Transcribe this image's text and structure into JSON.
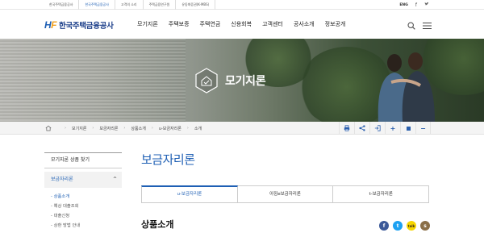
{
  "topbar": {
    "tabs": [
      {
        "label": "한국주택금융공사",
        "active": false
      },
      {
        "label": "한국주택금융공사",
        "active": true
      },
      {
        "label": "고객의 소리",
        "active": false
      },
      {
        "label": "주택금융연구원",
        "active": false
      },
      {
        "label": "유동화증권(K-MBS)",
        "active": false
      }
    ],
    "lang": "ENG",
    "facebook": "f",
    "twitter": "t"
  },
  "header": {
    "logo_mark": "HF",
    "logo_text": "한국주택금융공사",
    "nav": [
      "모기지론",
      "주택보증",
      "주택연금",
      "신용회복",
      "고객센터",
      "공사소개",
      "정보공개"
    ]
  },
  "hero": {
    "title": "모기지론"
  },
  "breadcrumb": [
    "모기지론",
    "보금자리론",
    "상품소개",
    "u-보금자리론",
    "소개"
  ],
  "tools": [
    "print",
    "share",
    "home",
    "plus",
    "stop",
    "minus"
  ],
  "lnb": {
    "title": "모기지론 상품 찾기",
    "section": "보금자리론",
    "section_caret": "^",
    "items": [
      {
        "label": "- 상품소개",
        "active": true
      },
      {
        "label": "- 예상 대출조회",
        "active": false
      },
      {
        "label": "- 대출신청",
        "active": false
      },
      {
        "label": "- 상환 방법 안내",
        "active": false
      }
    ]
  },
  "main": {
    "title": "보금자리론",
    "tabs": [
      {
        "label": "u-보금자리론",
        "active": true
      },
      {
        "label": "아낌e보금자리론",
        "active": false
      },
      {
        "label": "t-보금자리론",
        "active": false
      }
    ],
    "section_title": "상품소개"
  },
  "share": [
    {
      "icon": "facebook-icon",
      "text": "f",
      "color": "#3b5998"
    },
    {
      "icon": "twitter-icon",
      "text": "t",
      "color": "#1da1f2"
    },
    {
      "icon": "kakaotalk-icon",
      "text": "talk",
      "color": "#f7d600"
    },
    {
      "icon": "kakaostory-icon",
      "text": "s",
      "color": "#8a6f48"
    }
  ],
  "colors": {
    "brand": "#1e5fb4",
    "brand_dark": "#1c3f8a",
    "accent": "#f0a020"
  }
}
